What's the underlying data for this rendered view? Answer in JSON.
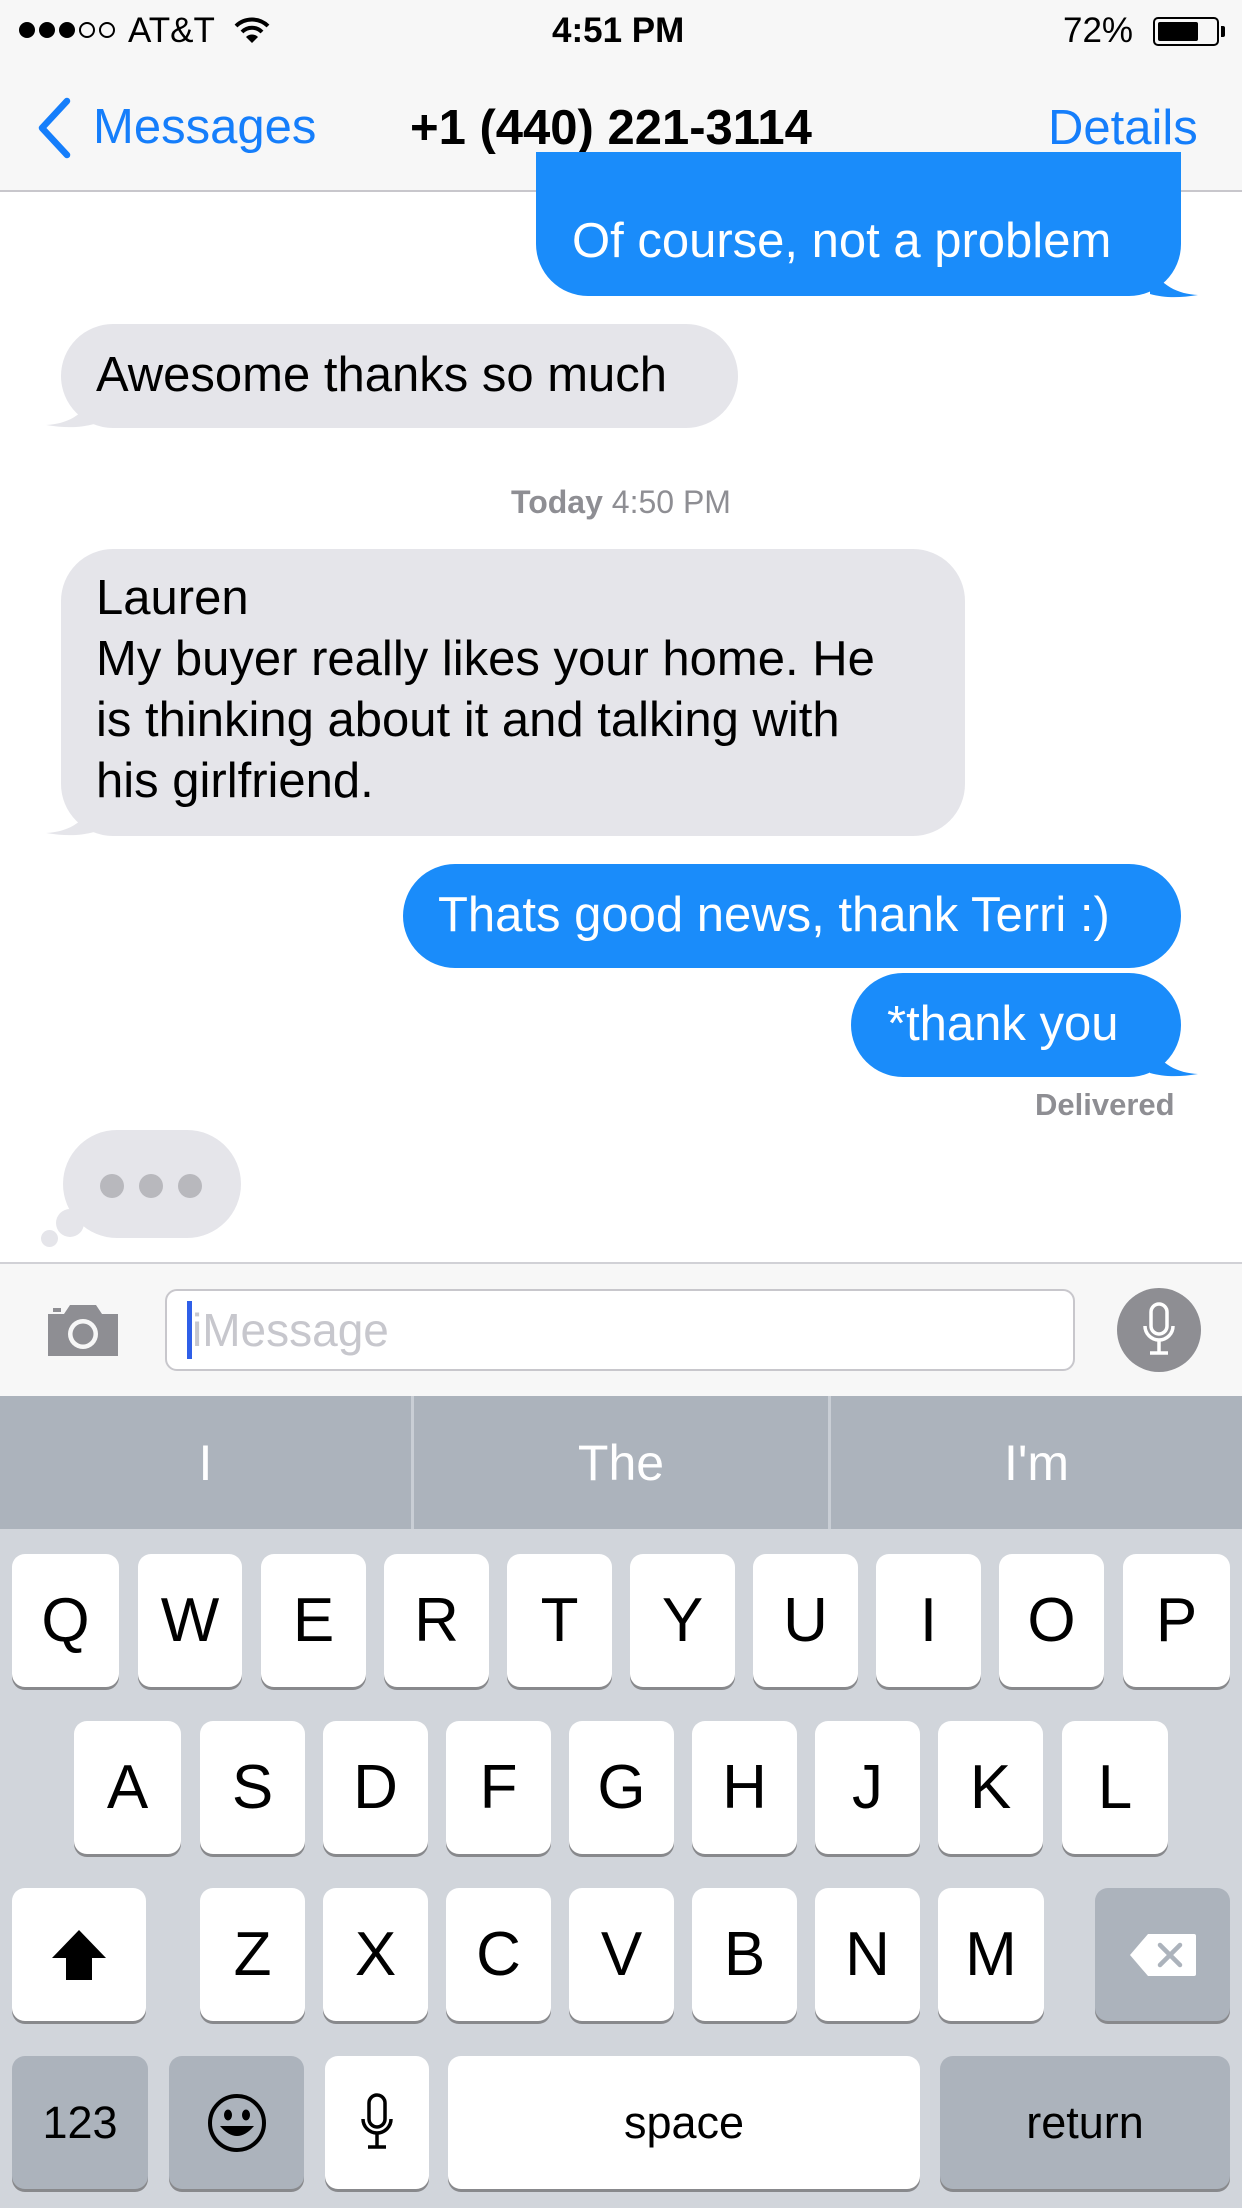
{
  "status_bar": {
    "carrier": "AT&T",
    "time": "4:51 PM",
    "battery_percent": "72%",
    "battery_level": 0.72,
    "signal_bars_filled": 3,
    "signal_bars_total": 5
  },
  "nav": {
    "back_label": "Messages",
    "title": "+1 (440) 221-3114",
    "details_label": "Details"
  },
  "conversation": {
    "msg1": "Of course, not a problem",
    "msg2": "Awesome thanks so much",
    "timestamp_day": "Today",
    "timestamp_time": "4:50 PM",
    "msg3_lines": [
      "Lauren",
      "My buyer really likes your home. He",
      "is thinking about it and talking with",
      "his girlfriend."
    ],
    "msg4": "Thats good news, thank Terri :)",
    "msg5": "*thank you",
    "delivered": "Delivered"
  },
  "input": {
    "placeholder": "iMessage",
    "value": ""
  },
  "keyboard": {
    "predictions": [
      "I",
      "The",
      "I'm"
    ],
    "row1": [
      "Q",
      "W",
      "E",
      "R",
      "T",
      "Y",
      "U",
      "I",
      "O",
      "P"
    ],
    "row2": [
      "A",
      "S",
      "D",
      "F",
      "G",
      "H",
      "J",
      "K",
      "L"
    ],
    "row3": [
      "Z",
      "X",
      "C",
      "V",
      "B",
      "N",
      "M"
    ],
    "numbers_label": "123",
    "space_label": "space",
    "return_label": "return"
  },
  "colors": {
    "outgoing_bubble": "#1a8cfa",
    "incoming_bubble": "#e5e5ea",
    "ios_blue": "#157efb",
    "keyboard_bg": "#d1d5db",
    "dark_key": "#acb3bc"
  },
  "icons": {
    "back": "chevron-left-icon",
    "wifi": "wifi-icon",
    "camera": "camera-icon",
    "mic": "microphone-icon",
    "shift": "shift-icon",
    "delete": "backspace-icon",
    "emoji": "emoji-icon",
    "dictation": "dictation-icon"
  }
}
